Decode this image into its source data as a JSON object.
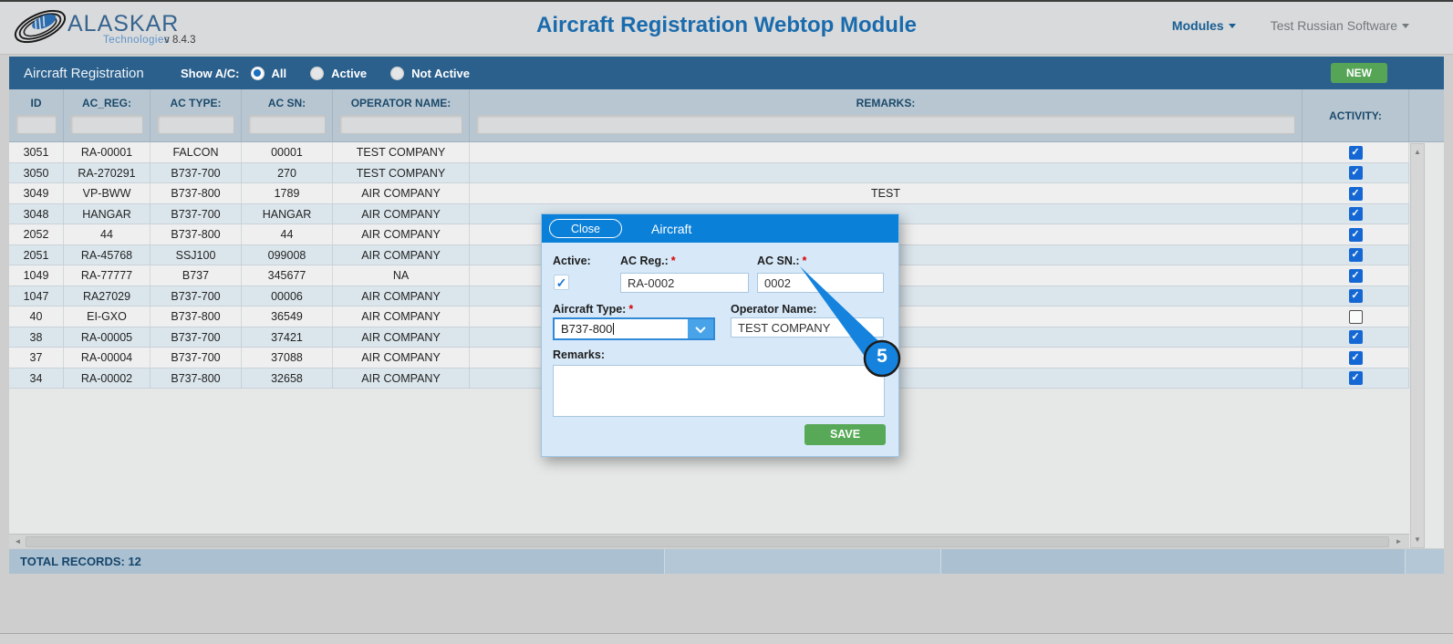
{
  "header": {
    "brand": "ALASKAR",
    "tagline": "Technologies",
    "version": "v 8.4.3",
    "title": "Aircraft Registration Webtop Module",
    "modules_menu": "Modules",
    "user_menu": "Test Russian Software"
  },
  "toolbar": {
    "panel_title": "Aircraft Registration",
    "show_label": "Show A/C:",
    "radios": [
      {
        "label": "All",
        "selected": true
      },
      {
        "label": "Active",
        "selected": false
      },
      {
        "label": "Not Active",
        "selected": false
      }
    ],
    "new_button": "NEW"
  },
  "table": {
    "columns": [
      "ID",
      "AC_REG:",
      "AC TYPE:",
      "AC SN:",
      "OPERATOR NAME:",
      "REMARKS:",
      "ACTIVITY:"
    ],
    "filters": {
      "id": "",
      "ac_reg": "",
      "ac_type": "",
      "ac_sn": "",
      "operator": "",
      "remarks": ""
    },
    "rows": [
      {
        "id": "3051",
        "ac_reg": "RA-00001",
        "ac_type": "FALCON",
        "ac_sn": "00001",
        "operator": "TEST COMPANY",
        "remarks": "",
        "active": true
      },
      {
        "id": "3050",
        "ac_reg": "RA-270291",
        "ac_type": "B737-700",
        "ac_sn": "270",
        "operator": "TEST COMPANY",
        "remarks": "",
        "active": true
      },
      {
        "id": "3049",
        "ac_reg": "VP-BWW",
        "ac_type": "B737-800",
        "ac_sn": "1789",
        "operator": "AIR COMPANY",
        "remarks": "TEST",
        "active": true
      },
      {
        "id": "3048",
        "ac_reg": "HANGAR",
        "ac_type": "B737-700",
        "ac_sn": "HANGAR",
        "operator": "AIR COMPANY",
        "remarks": "",
        "active": true
      },
      {
        "id": "2052",
        "ac_reg": "44",
        "ac_type": "B737-800",
        "ac_sn": "44",
        "operator": "AIR COMPANY",
        "remarks": "",
        "active": true
      },
      {
        "id": "2051",
        "ac_reg": "RA-45768",
        "ac_type": "SSJ100",
        "ac_sn": "099008",
        "operator": "AIR COMPANY",
        "remarks": "",
        "active": true
      },
      {
        "id": "1049",
        "ac_reg": "RA-77777",
        "ac_type": "B737",
        "ac_sn": "345677",
        "operator": "NA",
        "remarks": "",
        "active": true
      },
      {
        "id": "1047",
        "ac_reg": "RA27029",
        "ac_type": "B737-700",
        "ac_sn": "00006",
        "operator": "AIR COMPANY",
        "remarks": "",
        "active": true
      },
      {
        "id": "40",
        "ac_reg": "EI-GXO",
        "ac_type": "B737-800",
        "ac_sn": "36549",
        "operator": "AIR COMPANY",
        "remarks": "",
        "active": false
      },
      {
        "id": "38",
        "ac_reg": "RA-00005",
        "ac_type": "B737-700",
        "ac_sn": "37421",
        "operator": "AIR COMPANY",
        "remarks": "",
        "active": true
      },
      {
        "id": "37",
        "ac_reg": "RA-00004",
        "ac_type": "B737-700",
        "ac_sn": "37088",
        "operator": "AIR COMPANY",
        "remarks": "",
        "active": true
      },
      {
        "id": "34",
        "ac_reg": "RA-00002",
        "ac_type": "B737-800",
        "ac_sn": "32658",
        "operator": "AIR COMPANY",
        "remarks": "",
        "active": true
      }
    ],
    "footer_total": "TOTAL RECORDS: 12"
  },
  "modal": {
    "close_button": "Close",
    "title": "Aircraft",
    "required_marker": "*",
    "active_label": "Active:",
    "active_checked": true,
    "ac_reg_label": "AC Reg.:",
    "ac_reg_value": "RA-0002",
    "ac_sn_label": "AC SN.:",
    "ac_sn_value": "0002",
    "aircraft_type_label": "Aircraft Type:",
    "aircraft_type_value": "B737-800",
    "operator_label": "Operator Name:",
    "operator_value": "TEST COMPANY",
    "remarks_label": "Remarks:",
    "remarks_value": "",
    "save_button": "SAVE"
  },
  "callout": {
    "number": "5"
  },
  "colors": {
    "toolbar": "#2b608d",
    "grid_header": "#b7c6d1",
    "new_button": "#56a556",
    "save_button": "#57a957",
    "modal_header": "#0b80d8",
    "checkbox_blue": "#1568d4",
    "callout_blue": "#1583dd",
    "title_blue": "#1a6bad"
  }
}
